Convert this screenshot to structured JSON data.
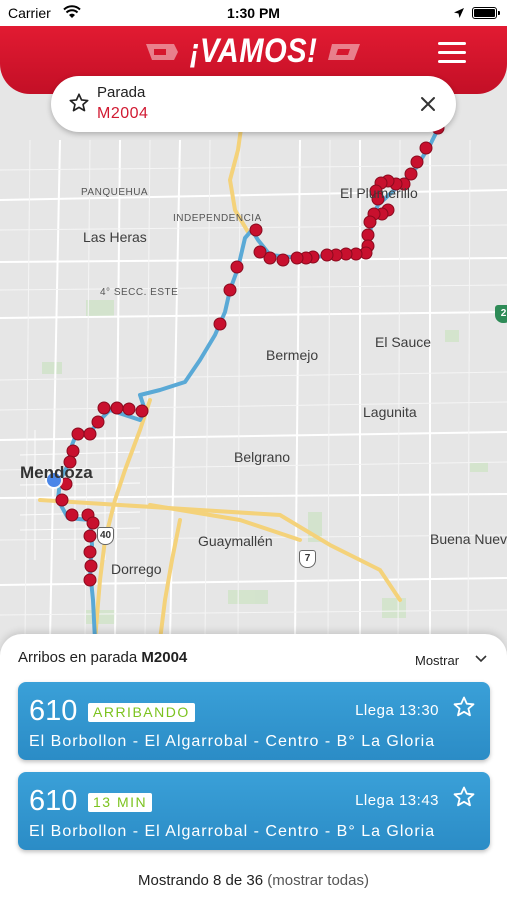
{
  "status_bar": {
    "carrier": "Carrier",
    "time": "1:30 PM"
  },
  "header": {
    "title": "¡VAMOS!",
    "menu_icon": "hamburger-menu-icon"
  },
  "stop": {
    "label": "Parada",
    "code": "M2004",
    "favorite_icon": "star-outline-icon",
    "close_icon": "close-icon"
  },
  "map": {
    "labels": {
      "panquehua": "PANQUEHUA",
      "independencia": "INDEPENDENCIA",
      "las_heras": "Las Heras",
      "cuarta_seccion": "4° SECC. ESTE",
      "el_plumerillo": "El Plumerillo",
      "el_sauce": "El Sauce",
      "bermejo": "Bermejo",
      "lagunita": "Lagunita",
      "belgrano": "Belgrano",
      "mendoza": "Mendoza",
      "guaymallen": "Guaymallén",
      "buena_nueva": "Buena Nueva",
      "dorrego": "Dorrego"
    },
    "route_shields": {
      "r40": "40",
      "r7": "7",
      "r2": "2"
    },
    "colors": {
      "route": "#5aa9d6",
      "stop": "#c8102e",
      "user": "#4a86e8"
    }
  },
  "arrivals": {
    "title_prefix": "Arribos en parada ",
    "title_code": "M2004",
    "toggle_label": "Mostrar",
    "items": [
      {
        "line": "610",
        "status": "ARRIBANDO",
        "eta": "Llega 13:30",
        "route": "El Borbollon - El Algarrobal - Centro - B° La Gloria"
      },
      {
        "line": "610",
        "status": "13 MIN",
        "eta": "Llega 13:43",
        "route": "El Borbollon - El Algarrobal - Centro - B° La Gloria"
      }
    ],
    "footer_count": "Mostrando 8 de 36",
    "footer_link": "(mostrar todas)"
  },
  "colors": {
    "brand_red": "#d11a32",
    "card_blue": "#3197d0",
    "badge_green": "#7cc31f"
  }
}
